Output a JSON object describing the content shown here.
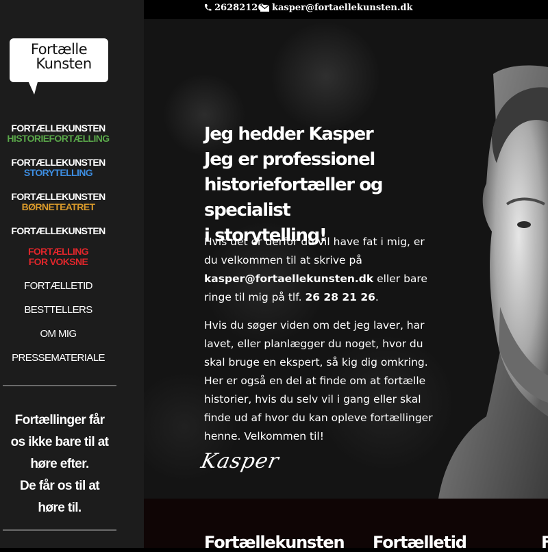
{
  "logo": {
    "line1": "Fortælle",
    "line2": "Kunsten"
  },
  "nav": {
    "groups": [
      {
        "brand": "FORTÆLLEKUNSTEN",
        "sub": "HISTORIEFORTÆLLING",
        "color": "#5aa84a"
      },
      {
        "brand": "FORTÆLLEKUNSTEN",
        "sub": "STORYTELLING",
        "color": "#3d8de0"
      },
      {
        "brand": "FORTÆLLEKUNSTEN",
        "sub": "BØRNETEATRET",
        "color": "#d99a2b"
      },
      {
        "brand": "FORTÆLLEKUNSTEN",
        "sub": "FORTÆLLING FOR VOKSNE",
        "color": "#e0262b"
      }
    ],
    "simple": [
      "FORTÆLLETID",
      "BESTTELLERS",
      "OM MIG",
      "PRESSEMATERIALE"
    ]
  },
  "quote": [
    "Fortællinger får",
    "os ikke bare til at",
    "høre efter.",
    "De får os til at",
    "høre til."
  ],
  "topbar": {
    "phone": "26282126",
    "email": "kasper@fortaellekunsten.dk"
  },
  "hero": {
    "title": [
      "Jeg hedder Kasper",
      "Jeg er professionel",
      "historiefortæller og specialist",
      "i storytelling!"
    ],
    "p1_a": "Hvis det er derfor du vil have fat i mig, er du velkommen til at skrive på ",
    "p1_email": "kasper@fortaellekunsten.dk",
    "p1_b": " eller bare ringe til mig på tlf. ",
    "p1_phone": "26 28 21 26",
    "p1_c": ".",
    "p2": "Hvis du søger viden om det jeg laver, har lavet, eller planlægger du noget, hvor du skal bruge en ekspert, så kig dig omkring. Her er også en del at finde om at fortælle historier, hvis du selv vil i gang eller skal finde ud af hvor du kan opleve fortællinger henne. Velkommen til!",
    "signature": "Kasper"
  },
  "bottom": {
    "col1": "Fortællekunsten",
    "col2": "Fortælletid",
    "col3": "F"
  }
}
